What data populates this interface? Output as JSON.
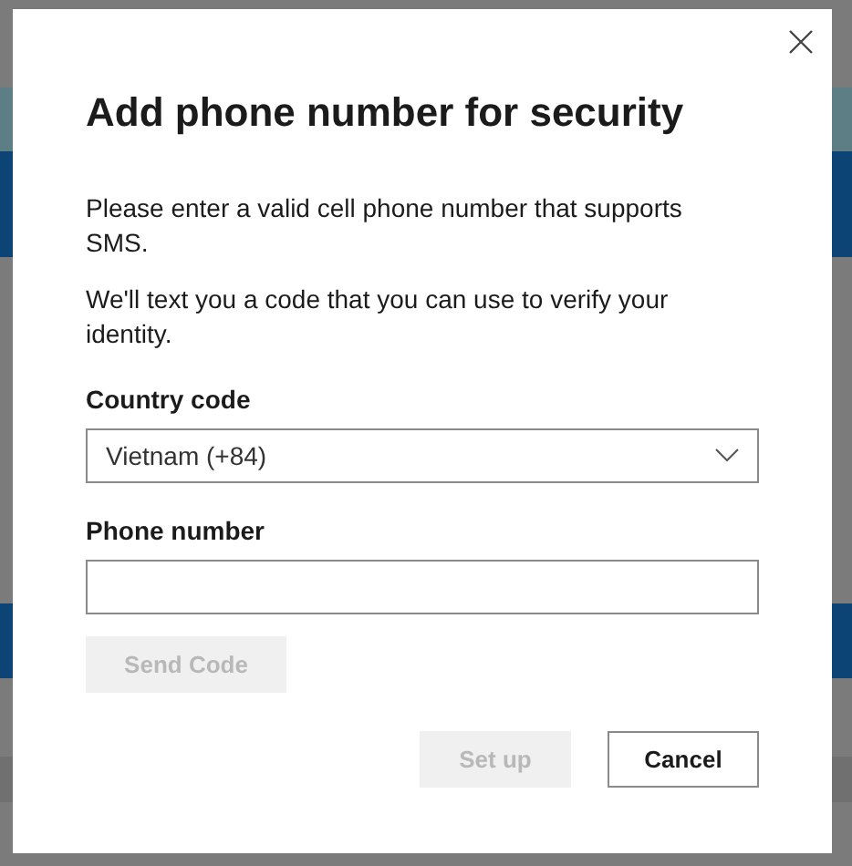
{
  "dialog": {
    "title": "Add phone number for security",
    "paragraphs": [
      "Please enter a valid cell phone number that supports SMS.",
      "We'll text you a code that you can use to verify your identity."
    ],
    "fields": [
      {
        "kind": "select",
        "label": "Country code",
        "value": "Vietnam (+84)"
      },
      {
        "kind": "input",
        "label": "Phone number"
      }
    ],
    "send_button": {
      "label": "Send Code",
      "disabled": true
    },
    "buttons": [
      {
        "label": "Set up",
        "disabled": true
      },
      {
        "label": "Cancel",
        "disabled": false
      }
    ]
  }
}
